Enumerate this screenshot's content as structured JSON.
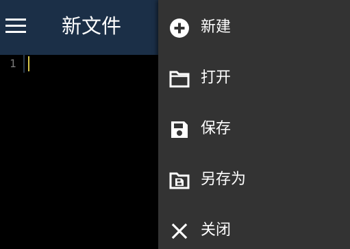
{
  "toolbar": {
    "title": "新文件",
    "menu_icon": "hamburger-menu-icon"
  },
  "editor": {
    "line_numbers": [
      "1"
    ]
  },
  "menu": {
    "items": [
      {
        "label": "新建",
        "icon": "add-circle-icon"
      },
      {
        "label": "打开",
        "icon": "folder-open-icon"
      },
      {
        "label": "保存",
        "icon": "save-icon"
      },
      {
        "label": "另存为",
        "icon": "save-as-folder-icon"
      },
      {
        "label": "关闭",
        "icon": "close-icon"
      }
    ]
  },
  "colors": {
    "toolbar_bg": "#1b2f47",
    "menu_bg": "#333333",
    "editor_bg": "#000000",
    "cursor": "#d7c64b",
    "line_number": "#7a7a7a"
  }
}
